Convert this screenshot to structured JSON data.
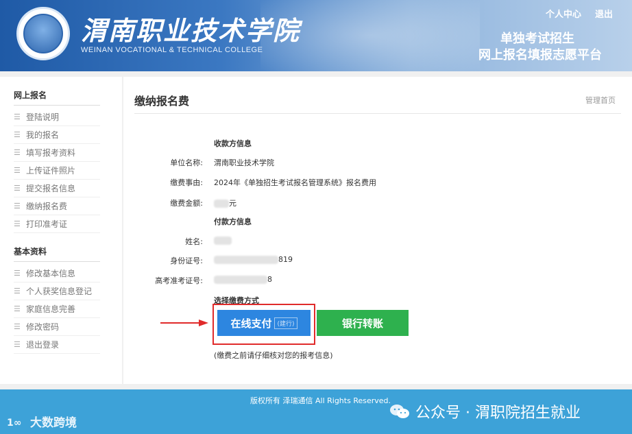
{
  "header": {
    "school_name_cn": "渭南职业技术学院",
    "school_name_en": "WEINAN VOCATIONAL & TECHNICAL COLLEGE",
    "links": [
      "个人中心",
      "退出"
    ],
    "platform_line1": "单独考试招生",
    "platform_line2": "网上报名填报志愿平台"
  },
  "sidebar": {
    "group1_title": "网上报名",
    "group1_items": [
      "登陆说明",
      "我的报名",
      "填写报考资料",
      "上传证件照片",
      "提交报名信息",
      "缴纳报名费",
      "打印准考证"
    ],
    "group2_title": "基本资料",
    "group2_items": [
      "修改基本信息",
      "个人获奖信息登记",
      "家庭信息完善",
      "修改密码",
      "退出登录"
    ]
  },
  "main": {
    "title": "缴纳报名费",
    "home_link": "管理首页",
    "payee_section": "收款方信息",
    "payee": {
      "unit_label": "单位名称:",
      "unit_value": "渭南职业技术学院",
      "reason_label": "缴费事由:",
      "reason_value": "2024年《单独招生考试报名管理系统》报名费用",
      "amount_label": "缴费金额:",
      "amount_suffix": "元"
    },
    "payer_section": "付款方信息",
    "payer": {
      "name_label": "姓名:",
      "id_label": "身份证号:",
      "id_suffix": "819",
      "exam_label": "高考准考证号:",
      "exam_suffix": "8"
    },
    "pay_method_title": "选择缴费方式",
    "btn_online": "在线支付",
    "btn_online_sub": "(建行)",
    "btn_bank": "银行转账",
    "note": "(缴费之前请仔细核对您的报考信息)"
  },
  "footer": {
    "copyright": "版权所有 泽瑞通信 All Rights Reserved.",
    "watermark_left": "大数跨境",
    "watermark_right": "公众号 · 渭职院招生就业"
  },
  "colors": {
    "online_button": "#2d86e0",
    "bank_button": "#2eb14e",
    "highlight": "#e02a2a",
    "footer": "#3da2d8"
  }
}
